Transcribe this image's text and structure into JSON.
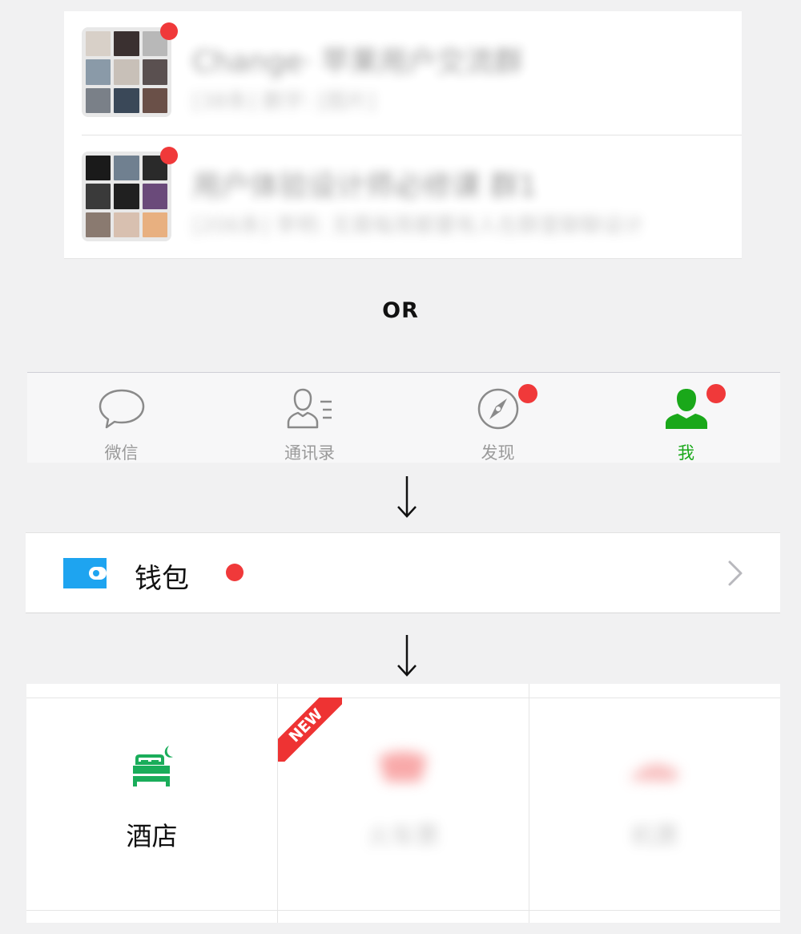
{
  "chat_list": {
    "items": [
      {
        "title": "Change· 苹果用户交流群",
        "preview": "[38条] 鹏宇: [图片]",
        "badge": true,
        "avatar_colors": [
          "#d8d0c8",
          "#3a3030",
          "#b8b8b8",
          "#8a9aa8",
          "#c8c0b8",
          "#5a5050",
          "#7a8088",
          "#3a4858",
          "#6a5048"
        ]
      },
      {
        "title": "用户体验设计师必修课 群1",
        "preview": "[206条] 李明: 无需每周都要有人在群里聊聊设计",
        "badge": true,
        "avatar_colors": [
          "#1a1a1a",
          "#708090",
          "#2a2a2a",
          "#3a3a3a",
          "#202020",
          "#6a4a7a",
          "#8a7a70",
          "#d8c0b0",
          "#e8b080"
        ]
      }
    ]
  },
  "separator": {
    "text": "OR"
  },
  "tabbar": {
    "tabs": [
      {
        "label": "微信",
        "icon": "chat-bubble-icon",
        "badge": false
      },
      {
        "label": "通讯录",
        "icon": "contacts-icon",
        "badge": false
      },
      {
        "label": "发现",
        "icon": "compass-icon",
        "badge": true
      },
      {
        "label": "我",
        "icon": "person-icon",
        "badge": true
      }
    ]
  },
  "wallet": {
    "label": "钱包",
    "icon": "wallet-icon",
    "badge": true
  },
  "services": {
    "cells": [
      {
        "label": "酒店",
        "icon": "hotel-bed-icon"
      },
      {
        "label": "火车票",
        "icon": "train-icon",
        "new_badge": "NEW"
      },
      {
        "label": "机票",
        "icon": "plane-icon"
      }
    ]
  },
  "colors": {
    "accent_green": "#1aa81a",
    "badge_red": "#f0393a",
    "wallet_blue": "#1ea4f0",
    "hotel_green": "#1aad5a",
    "new_red": "#ee3333"
  }
}
